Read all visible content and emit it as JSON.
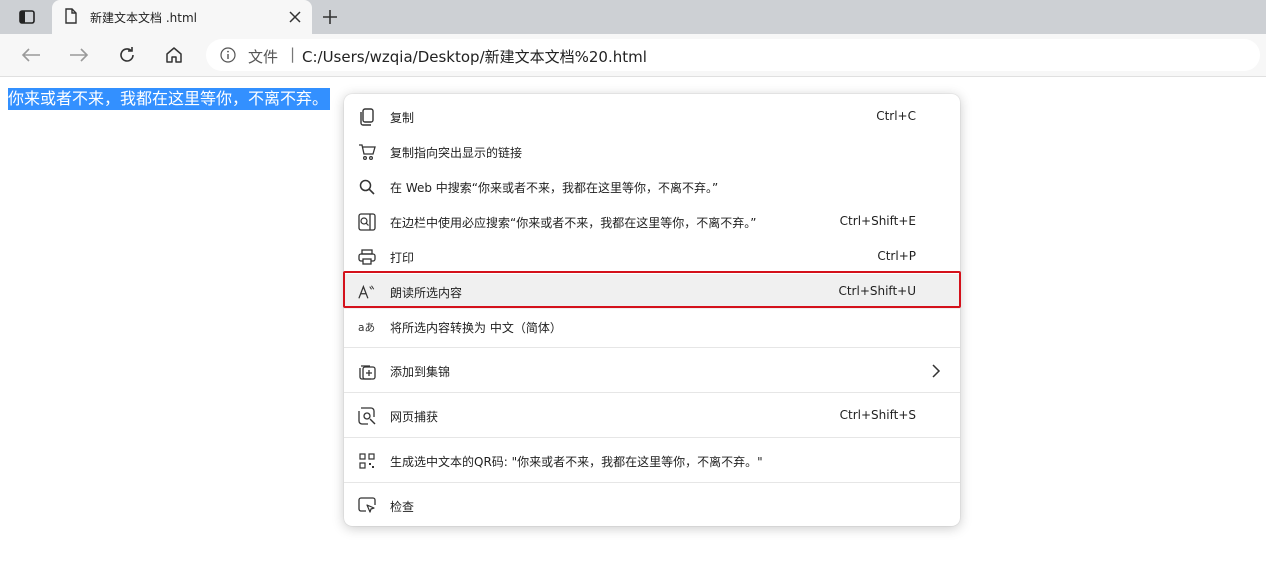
{
  "browser": {
    "tab": {
      "title": "新建文本文档 .html"
    },
    "address": {
      "scheme_label": "文件",
      "separator": "|",
      "url": "C:/Users/wzqia/Desktop/新建文本文档%20.html"
    }
  },
  "page": {
    "selected_text": "你来或者不来，我都在这里等你，不离不弃。"
  },
  "context_menu": {
    "items": [
      {
        "icon": "copy-icon",
        "label": "复制",
        "shortcut": "Ctrl+C"
      },
      {
        "icon": "copy-link-highlight-icon",
        "label": "复制指向突出显示的链接",
        "shortcut": ""
      },
      {
        "icon": "search-icon",
        "label": "在 Web 中搜索“你来或者不来，我都在这里等你，不离不弃。”",
        "shortcut": ""
      },
      {
        "icon": "sidebar-search-icon",
        "label": "在边栏中使用必应搜索“你来或者不来，我都在这里等你，不离不弃。”",
        "shortcut": "Ctrl+Shift+E"
      },
      {
        "icon": "print-icon",
        "label": "打印",
        "shortcut": "Ctrl+P"
      },
      {
        "icon": "read-aloud-icon",
        "label": "朗读所选内容",
        "shortcut": "Ctrl+Shift+U"
      },
      {
        "icon": "translate-icon",
        "label": "将所选内容转换为 中文（简体）",
        "shortcut": ""
      },
      {
        "icon": "add-to-collections-icon",
        "label": "添加到集锦",
        "shortcut": ""
      },
      {
        "icon": "web-capture-icon",
        "label": "网页捕获",
        "shortcut": "Ctrl+Shift+S"
      },
      {
        "icon": "qr-code-icon",
        "label": "生成选中文本的QR码: \"你来或者不来，我都在这里等你，不离不弃。\"",
        "shortcut": ""
      },
      {
        "icon": "inspect-icon",
        "label": "检查",
        "shortcut": ""
      }
    ],
    "highlighted_item": "朗读所选内容",
    "highlight_color": "#d4111b"
  },
  "colors": {
    "selection": "#3390ff",
    "tabstrip": "#cdd0d4",
    "toolbar": "#f7f7f7"
  }
}
